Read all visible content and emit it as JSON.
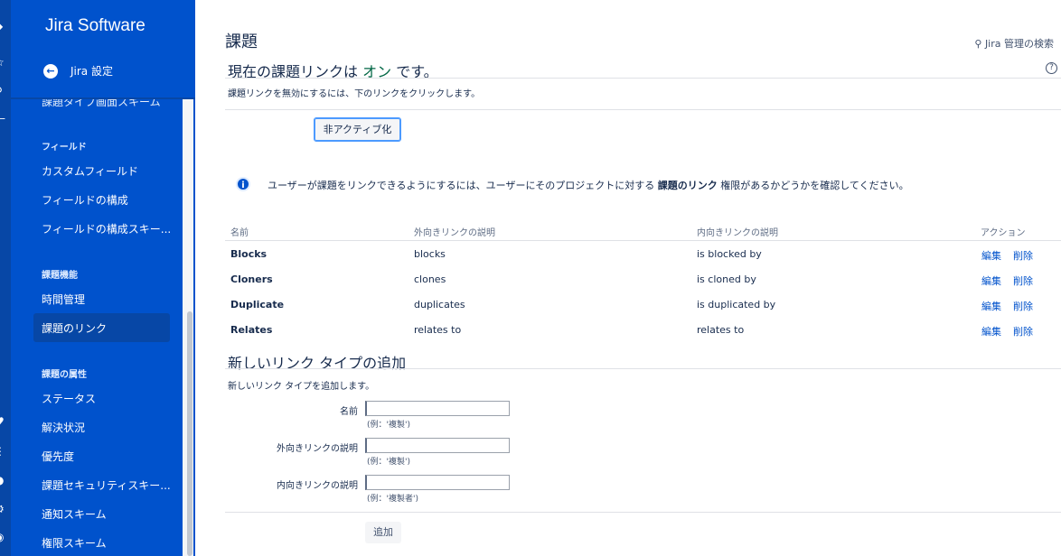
{
  "app": {
    "brand": "Jira Software",
    "back_label": "Jira 設定"
  },
  "sidebar": {
    "cut_item": "課題タイプ画面スキーム",
    "groups": [
      {
        "heading": "フィールド",
        "items": [
          "カスタムフィールド",
          "フィールドの構成",
          "フィールドの構成スキー..."
        ]
      },
      {
        "heading": "課題機能",
        "items": [
          "時間管理",
          "課題のリンク"
        ]
      },
      {
        "heading": "課題の属性",
        "items": [
          "ステータス",
          "解決状況",
          "優先度",
          "課題セキュリティスキー...",
          "通知スキーム",
          "権限スキーム"
        ]
      }
    ],
    "active": "課題のリンク"
  },
  "header": {
    "title": "課題",
    "admin_search": "Jira 管理の検索"
  },
  "status": {
    "prefix": "現在の課題リンクは",
    "state": "オン",
    "suffix": "です。",
    "disable_hint": "課題リンクを無効にするには、下のリンクをクリックします。",
    "deactivate_label": "非アクティブ化"
  },
  "info": {
    "before": "ユーザーが課題をリンクできるようにするには、ユーザーにそのプロジェクトに対する",
    "bold": "課題のリンク",
    "after": "権限があるかどうかを確認してください。"
  },
  "table": {
    "headers": [
      "名前",
      "外向きリンクの説明",
      "内向きリンクの説明",
      "アクション"
    ],
    "rows": [
      {
        "name": "Blocks",
        "outward": "blocks",
        "inward": "is blocked by"
      },
      {
        "name": "Cloners",
        "outward": "clones",
        "inward": "is cloned by"
      },
      {
        "name": "Duplicate",
        "outward": "duplicates",
        "inward": "is duplicated by"
      },
      {
        "name": "Relates",
        "outward": "relates to",
        "inward": "relates to"
      }
    ],
    "edit_label": "編集",
    "delete_label": "削除"
  },
  "add_form": {
    "title": "新しいリンク タイプの追加",
    "desc": "新しいリンク タイプを追加します。",
    "name_label": "名前",
    "name_hint": "(例：'複製')",
    "outward_label": "外向きリンクの説明",
    "outward_hint": "(例：'複製')",
    "inward_label": "内向きリンクの説明",
    "inward_hint": "(例：'複製者')",
    "submit_label": "追加"
  }
}
